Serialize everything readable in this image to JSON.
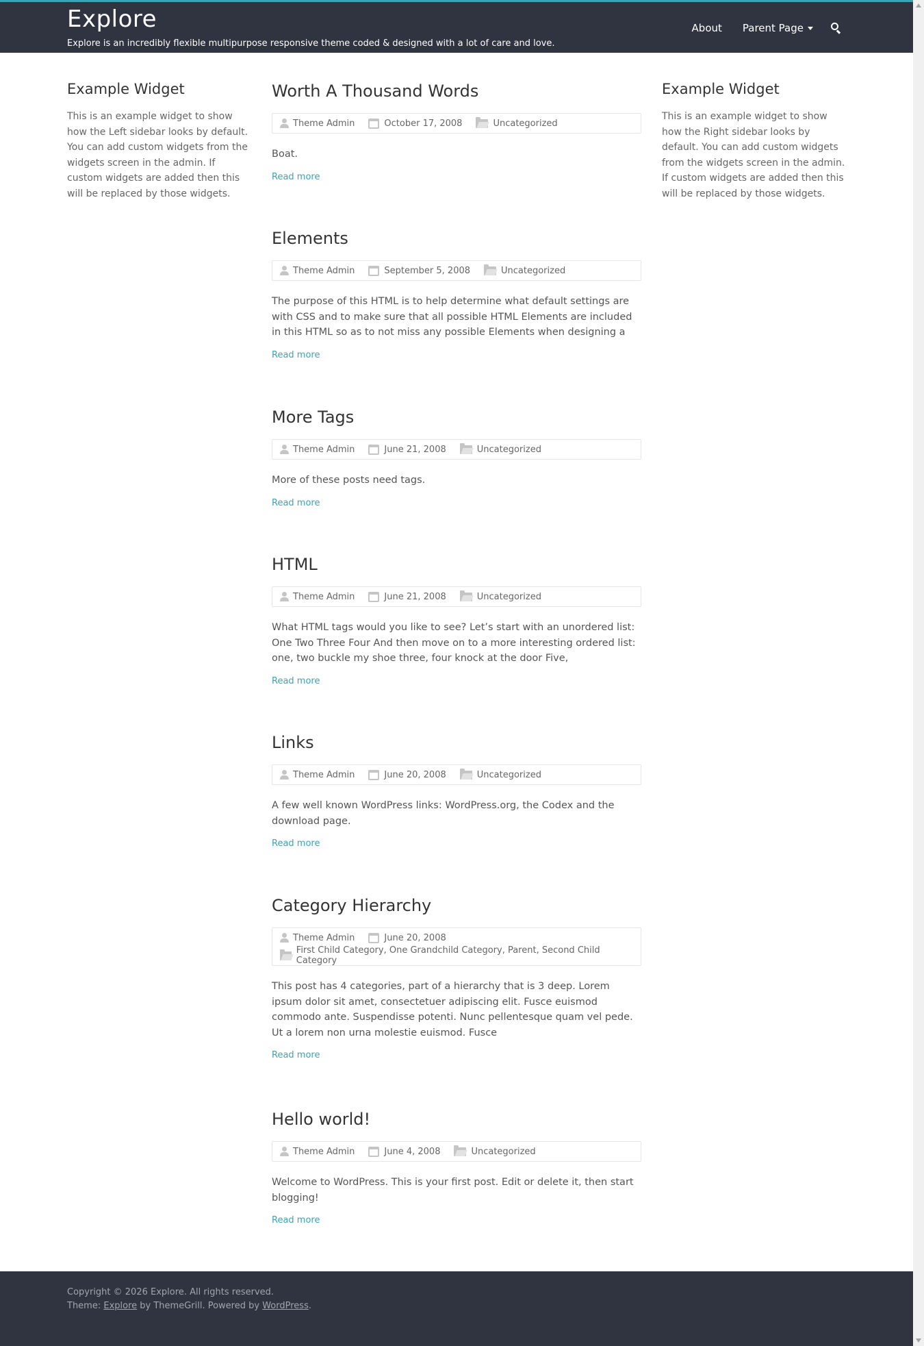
{
  "header": {
    "site_title": "Explore",
    "site_description": "Explore is an incredibly flexible multipurpose responsive theme coded & designed with a lot of care and love.",
    "nav": {
      "about": "About",
      "parent_page": "Parent Page"
    },
    "search_icon": "search-icon"
  },
  "sidebar_left": {
    "title": "Example Widget",
    "text": "This is an example widget to show how the Left sidebar looks by default. You can add custom widgets from the widgets screen in the admin. If custom widgets are added then this will be replaced by those widgets."
  },
  "sidebar_right": {
    "title": "Example Widget",
    "text": "This is an example widget to show how the Right sidebar looks by default. You can add custom widgets from the widgets screen in the admin. If custom widgets are added then this will be replaced by those widgets."
  },
  "posts": [
    {
      "title": "Worth A Thousand Words",
      "author": "Theme Admin",
      "date": "October 17, 2008",
      "categories": "Uncategorized",
      "excerpt": "Boat.",
      "read_more": "Read more"
    },
    {
      "title": "Elements",
      "author": "Theme Admin",
      "date": "September 5, 2008",
      "categories": "Uncategorized",
      "excerpt": "The purpose of this HTML is to help determine what default settings are with CSS and to make sure that all possible HTML Elements are included in this HTML so as to not miss any possible Elements when designing a",
      "read_more": "Read more"
    },
    {
      "title": "More Tags",
      "author": "Theme Admin",
      "date": "June 21, 2008",
      "categories": "Uncategorized",
      "excerpt": "More of these posts need tags.",
      "read_more": "Read more"
    },
    {
      "title": "HTML",
      "author": "Theme Admin",
      "date": "June 21, 2008",
      "categories": "Uncategorized",
      "excerpt": "What HTML tags would you like to see? Let’s start with an unordered list: One Two Three Four And then move on to a more interesting ordered list: one, two buckle my shoe three, four knock at the door Five,",
      "read_more": "Read more"
    },
    {
      "title": "Links",
      "author": "Theme Admin",
      "date": "June 20, 2008",
      "categories": "Uncategorized",
      "excerpt": "A few well known WordPress links: WordPress.org, the Codex and the download page.",
      "read_more": "Read more"
    },
    {
      "title": "Category Hierarchy",
      "author": "Theme Admin",
      "date": "June 20, 2008",
      "categories": "First Child Category, One Grandchild Category, Parent, Second Child Category",
      "excerpt": "This post has 4 categories, part of a hierarchy that is 3 deep. Lorem ipsum dolor sit amet, consectetuer adipiscing elit. Fusce euismod commodo ante. Suspendisse potenti. Nunc pellentesque quam vel pede. Ut a lorem non urna molestie euismod. Fusce",
      "read_more": "Read more"
    },
    {
      "title": "Hello world!",
      "author": "Theme Admin",
      "date": "June 4, 2008",
      "categories": "Uncategorized",
      "excerpt": "Welcome to WordPress. This is your first post. Edit or delete it, then start blogging!",
      "read_more": "Read more"
    }
  ],
  "footer": {
    "copyright_prefix": "Copyright © 2026 ",
    "site_link": "Explore",
    "copyright_suffix": ". All rights reserved.",
    "theme_prefix": "Theme: ",
    "theme_link": "Explore",
    "theme_middle": " by ThemeGrill. Powered by ",
    "wp_link": "WordPress",
    "theme_suffix": "."
  },
  "colors": {
    "header_bg": "#2f3440",
    "accent": "#3aa3b5",
    "footer_bg": "#2f3440"
  }
}
